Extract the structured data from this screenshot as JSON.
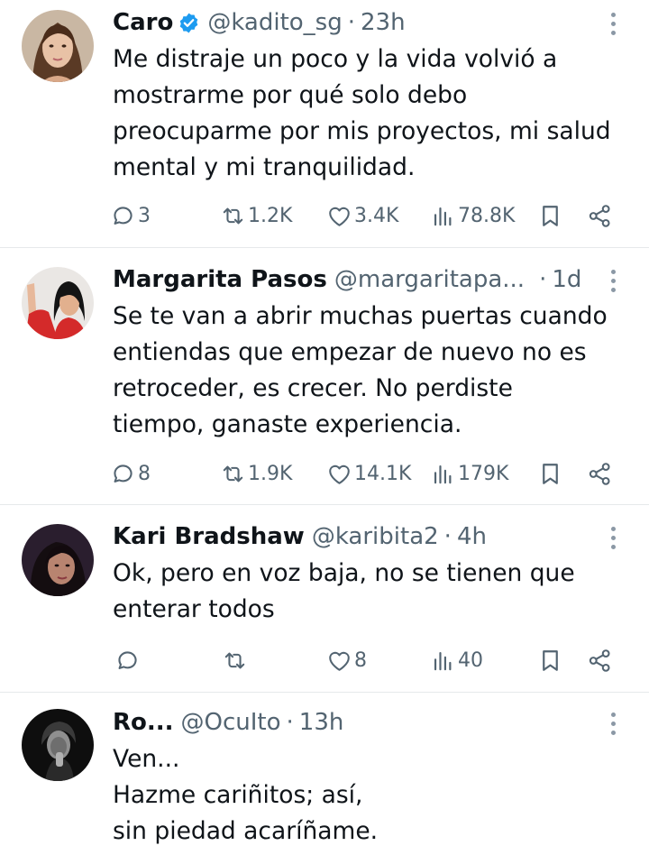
{
  "tweets": [
    {
      "name": "Caro",
      "handle": "@kadito_sg",
      "separator": "·",
      "time": "23h",
      "verified": true,
      "lines": [
        "Me distraje un poco y la vida volvió a",
        "mostrarme por qué solo debo",
        "preocuparme por mis proyectos, mi salud",
        "mental y mi tranquilidad."
      ],
      "replies": "3",
      "retweets": "1.2K",
      "likes": "3.4K",
      "views": "78.8K"
    },
    {
      "name": "Margarita Pasos",
      "handle": "@margaritapa...",
      "separator": "·",
      "time": "1d",
      "verified": false,
      "lines": [
        "Se te van a abrir muchas puertas cuando",
        "entiendas que empezar de nuevo no es",
        "retroceder, es crecer. No perdiste",
        "tiempo, ganaste experiencia."
      ],
      "replies": "8",
      "retweets": "1.9K",
      "likes": "14.1K",
      "views": "179K"
    },
    {
      "name": "Kari Bradshaw",
      "handle": "@karibita2",
      "separator": "·",
      "time": "4h",
      "verified": false,
      "lines": [
        "Ok, pero en voz baja, no se tienen que",
        "enterar todos"
      ],
      "replies": "",
      "retweets": "",
      "likes": "8",
      "views": "40"
    },
    {
      "name": "Ro...",
      "handle": "@OcuIto",
      "separator": "·",
      "time": "13h",
      "verified": false,
      "lines": [
        "Ven...",
        "Hazme cariñitos; así,",
        "sin piedad acaríñame."
      ]
    }
  ],
  "icons": {
    "reply": "reply-icon",
    "retweet": "retweet-icon",
    "like": "heart-icon",
    "views": "views-icon",
    "bookmark": "bookmark-icon",
    "share": "share-icon",
    "more": "more-vertical-icon",
    "verified": "verified-badge-icon"
  },
  "colors": {
    "text": "#0f1419",
    "secondary": "#536471",
    "verified": "#1d9bf0",
    "divider": "#e6e9eb"
  }
}
